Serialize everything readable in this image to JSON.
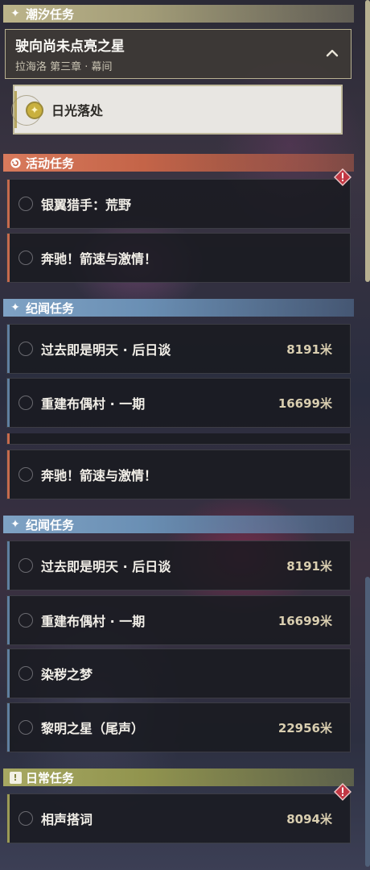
{
  "sections": {
    "tide": {
      "title": "潮汐任务"
    },
    "event": {
      "title": "活动任务"
    },
    "lore": {
      "title": "纪闻任务"
    },
    "daily": {
      "title": "日常任务"
    }
  },
  "tide_quest": {
    "title": "驶向尚未点亮之星",
    "subtitle": "拉海洛 第三章 · 幕间",
    "active_step": "日光落处"
  },
  "event_quests": [
    {
      "name": "银翼猎手：荒野"
    },
    {
      "name": "奔驰！箭速与激情！"
    }
  ],
  "lore_quests": [
    {
      "name": "过去即是明天 · 后日谈",
      "distance": "8191米"
    },
    {
      "name": "重建布偶村 · 一期",
      "distance": "16699米"
    }
  ],
  "event_quests_second": [
    {
      "name": "奔驰！箭速与激情！"
    }
  ],
  "lore_quests_second": [
    {
      "name": "过去即是明天 · 后日谈",
      "distance": "8191米"
    },
    {
      "name": "重建布偶村 · 一期",
      "distance": "16699米"
    },
    {
      "name": "染秽之梦"
    },
    {
      "name": "黎明之星（尾声）",
      "distance": "22956米"
    }
  ],
  "daily_quests": [
    {
      "name": "相声搭词",
      "distance": "8094米"
    }
  ],
  "colors": {
    "tide": "#bcb48a",
    "event": "#d87a5c",
    "lore": "#7fa2c4",
    "daily": "#a7a862"
  },
  "icons": {
    "tide_header": "sparkle-icon",
    "event_header": "event-icon",
    "lore_header": "sparkle-icon",
    "daily_header": "exclamation-icon",
    "collapse": "chevron-up-icon",
    "sun": "sun-marker-icon",
    "warning": "warning-diamond-icon"
  }
}
